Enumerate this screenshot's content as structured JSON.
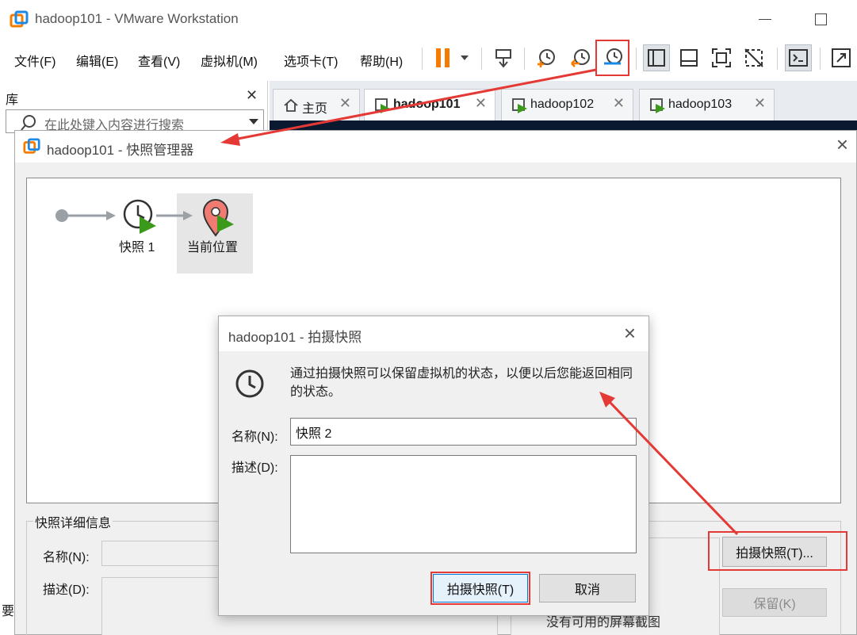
{
  "window": {
    "title": "hadoop101 - VMware Workstation"
  },
  "menu": {
    "items": [
      "文件(F)",
      "编辑(E)",
      "查看(V)",
      "虚拟机(M)",
      "选项卡(T)",
      "帮助(H)"
    ]
  },
  "library": {
    "title": "库",
    "search_placeholder": "在此处键入内容进行搜索",
    "footer_text": "要"
  },
  "tabs": [
    {
      "label": "主页",
      "icon": "home-icon"
    },
    {
      "label": "hadoop101",
      "icon": "vm-icon",
      "active": true
    },
    {
      "label": "hadoop102",
      "icon": "vm-icon"
    },
    {
      "label": "hadoop103",
      "icon": "vm-icon"
    }
  ],
  "snapshot_manager": {
    "title": "hadoop101 - 快照管理器",
    "tree": {
      "snapshot_label": "快照 1",
      "current_label": "当前位置"
    },
    "details": {
      "legend": "快照详细信息",
      "name_label": "名称(N):",
      "desc_label": "描述(D):",
      "no_screenshot": "没有可用的屏幕截图"
    },
    "buttons": {
      "take_snapshot": "拍摄快照(T)...",
      "keep": "保留(K)"
    }
  },
  "take_snapshot_dialog": {
    "title": "hadoop101 - 拍摄快照",
    "description": "通过拍摄快照可以保留虚拟机的状态，以便以后您能返回相同的状态。",
    "name_label": "名称(N):",
    "name_value": "快照 2",
    "desc_label": "描述(D):",
    "ok_button": "拍摄快照(T)",
    "cancel_button": "取消"
  },
  "colors": {
    "annotation_red": "#e53935",
    "vm_console": "#0a1830",
    "play_green": "#3c9a1b",
    "pause_orange": "#f57c00"
  }
}
